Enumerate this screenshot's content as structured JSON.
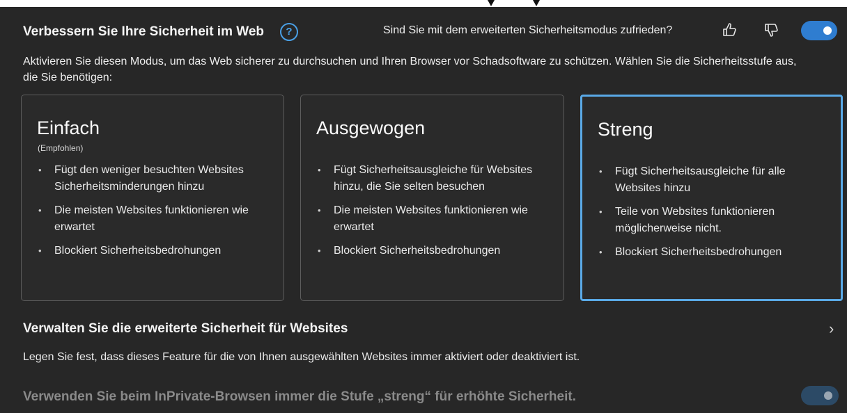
{
  "header": {
    "title": "Verbessern Sie Ihre Sicherheit im Web",
    "help_glyph": "?",
    "feedback_question": "Sind Sie mit dem erweiterten Sicherheitsmodus zufrieden?",
    "toggle_on": true
  },
  "description": "Aktivieren Sie diesen Modus, um das Web sicherer zu durchsuchen und Ihren Browser vor Schadsoftware zu schützen. Wählen Sie die Sicherheitsstufe aus, die Sie benötigen:",
  "cards": [
    {
      "title": "Einfach",
      "subtitle": "(Empfohlen)",
      "bullets": [
        "Fügt den weniger besuchten Websites Sicherheitsminderungen hinzu",
        "Die meisten Websites funktionieren wie erwartet",
        "Blockiert Sicherheitsbedrohungen"
      ]
    },
    {
      "title": "Ausgewogen",
      "bullets": [
        "Fügt Sicherheitsausgleiche für Websites hinzu, die Sie selten besuchen",
        "Die meisten Websites funktionieren wie erwartet",
        "Blockiert Sicherheitsbedrohungen"
      ]
    },
    {
      "title": "Streng",
      "selected": true,
      "bullets": [
        "Fügt Sicherheitsausgleiche für alle Websites hinzu",
        "Teile von Websites funktionieren möglicherweise nicht.",
        "Blockiert Sicherheitsbedrohungen"
      ]
    }
  ],
  "manage": {
    "title": "Verwalten Sie die erweiterte Sicherheit für Websites",
    "description": "Legen Sie fest, dass dieses Feature für die von Ihnen ausgewählten Websites immer aktiviert oder deaktiviert ist.",
    "chevron": "›"
  },
  "inprivate": {
    "label": "Verwenden Sie beim InPrivate-Browsen immer die Stufe „streng“ für erhöhte Sicherheit.",
    "toggle_on": true,
    "disabled": true
  },
  "colors": {
    "accent": "#2f7dd0",
    "selected_border": "#5aa9e6",
    "background": "#272727"
  },
  "icons": [
    "question-circle-icon",
    "thumbs-up-icon",
    "thumbs-down-icon",
    "chevron-right-icon"
  ]
}
